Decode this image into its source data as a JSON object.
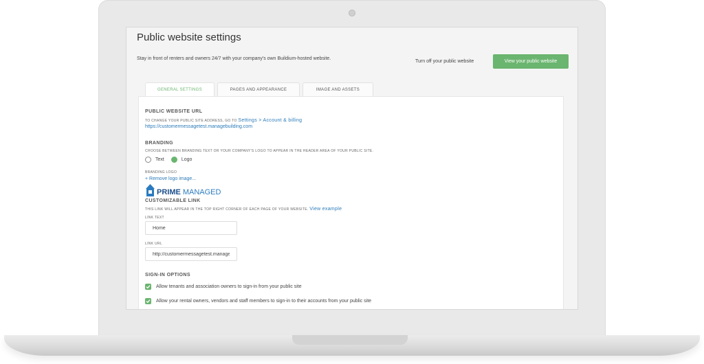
{
  "page": {
    "title": "Public website settings",
    "intro": "Stay in front of renters and owners 24/7 with your company's own Buildium-hosted website.",
    "turn_off_label": "Turn off your public website",
    "view_site_label": "View your public website"
  },
  "tabs": [
    {
      "label": "GENERAL SETTINGS",
      "active": true
    },
    {
      "label": "PAGES AND APPEARANCE",
      "active": false
    },
    {
      "label": "IMAGE AND ASSETS",
      "active": false
    }
  ],
  "public_url": {
    "heading": "PUBLIC WEBSITE URL",
    "instruction": "TO CHANGE YOUR PUBLIC SITE ADDRESS, GO TO",
    "settings_link": "Settings > Account & billing",
    "url": "https://customermessagetest.managebuilding.com"
  },
  "branding": {
    "heading": "BRANDING",
    "instruction": "CHOOSE BETWEEN BRANDING TEXT OR YOUR COMPANY'S LOGO TO APPEAR IN THE HEADER AREA OF YOUR PUBLIC SITE.",
    "options": [
      {
        "label": "Text",
        "selected": false
      },
      {
        "label": "Logo",
        "selected": true
      }
    ],
    "logo_label": "BRANDING LOGO",
    "remove_logo_label": "+ Remove logo image...",
    "logo_bold": "PRIME",
    "logo_light": "MANAGED"
  },
  "custom_link": {
    "heading": "CUSTOMIZABLE LINK",
    "instruction": "THIS LINK WILL APPEAR IN THE TOP RIGHT CORNER OF EACH PAGE OF YOUR WEBSITE.",
    "view_example": "View example",
    "link_text_label": "LINK TEXT",
    "link_text_value": "Home",
    "link_url_label": "LINK URL",
    "link_url_value": "http://customermessagetest.managebuilding.com"
  },
  "sign_in": {
    "heading": "SIGN-IN OPTIONS",
    "options": [
      {
        "label": "Allow tenants and association owners to sign-in from your public site",
        "checked": true
      },
      {
        "label": "Allow your rental owners, vendors and staff members to sign-in to their accounts from your public site",
        "checked": true
      }
    ]
  },
  "colors": {
    "accent_green": "#6ab56f",
    "link_blue": "#2a7ab8",
    "logo_navy": "#1b4f8a"
  }
}
